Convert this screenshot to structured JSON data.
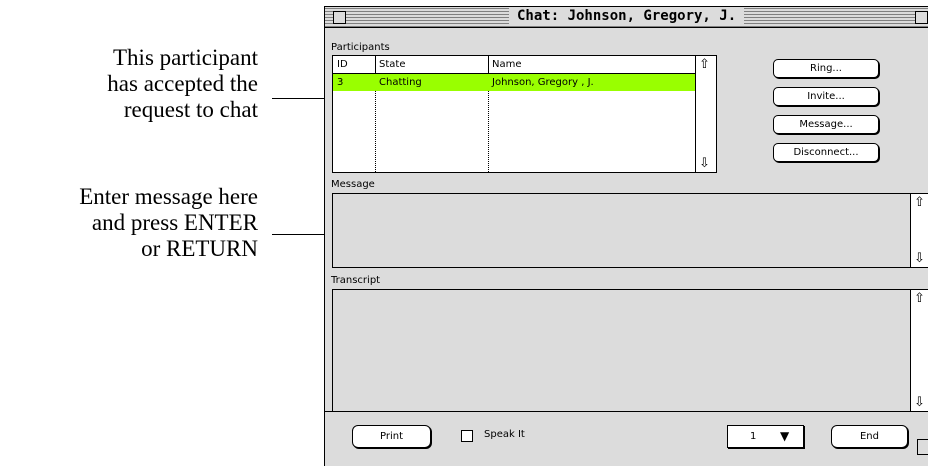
{
  "annotations": {
    "participant_note": "This participant\nhas accepted the\nrequest to chat",
    "message_note": "Enter message here\nand press ENTER\nor RETURN"
  },
  "window": {
    "title": "Chat: Johnson, Gregory, J."
  },
  "participants": {
    "label": "Participants",
    "columns": [
      "ID",
      "State",
      "Name"
    ],
    "rows": [
      {
        "id": "3",
        "state": "Chatting",
        "name": "Johnson, Gregory , J.",
        "highlight": "#99ff00"
      }
    ]
  },
  "buttons": {
    "ring": "Ring...",
    "invite": "Invite...",
    "message": "Message...",
    "disconnect": "Disconnect..."
  },
  "message": {
    "label": "Message",
    "value": ""
  },
  "transcript": {
    "label": "Transcript",
    "value": ""
  },
  "footer": {
    "print": "Print",
    "speak_it": "Speak It",
    "speak_checked": false,
    "count": "1",
    "end": "End"
  },
  "icons": {
    "scroll_up": "⇧",
    "scroll_down": "⇩",
    "dropdown": "▼"
  }
}
